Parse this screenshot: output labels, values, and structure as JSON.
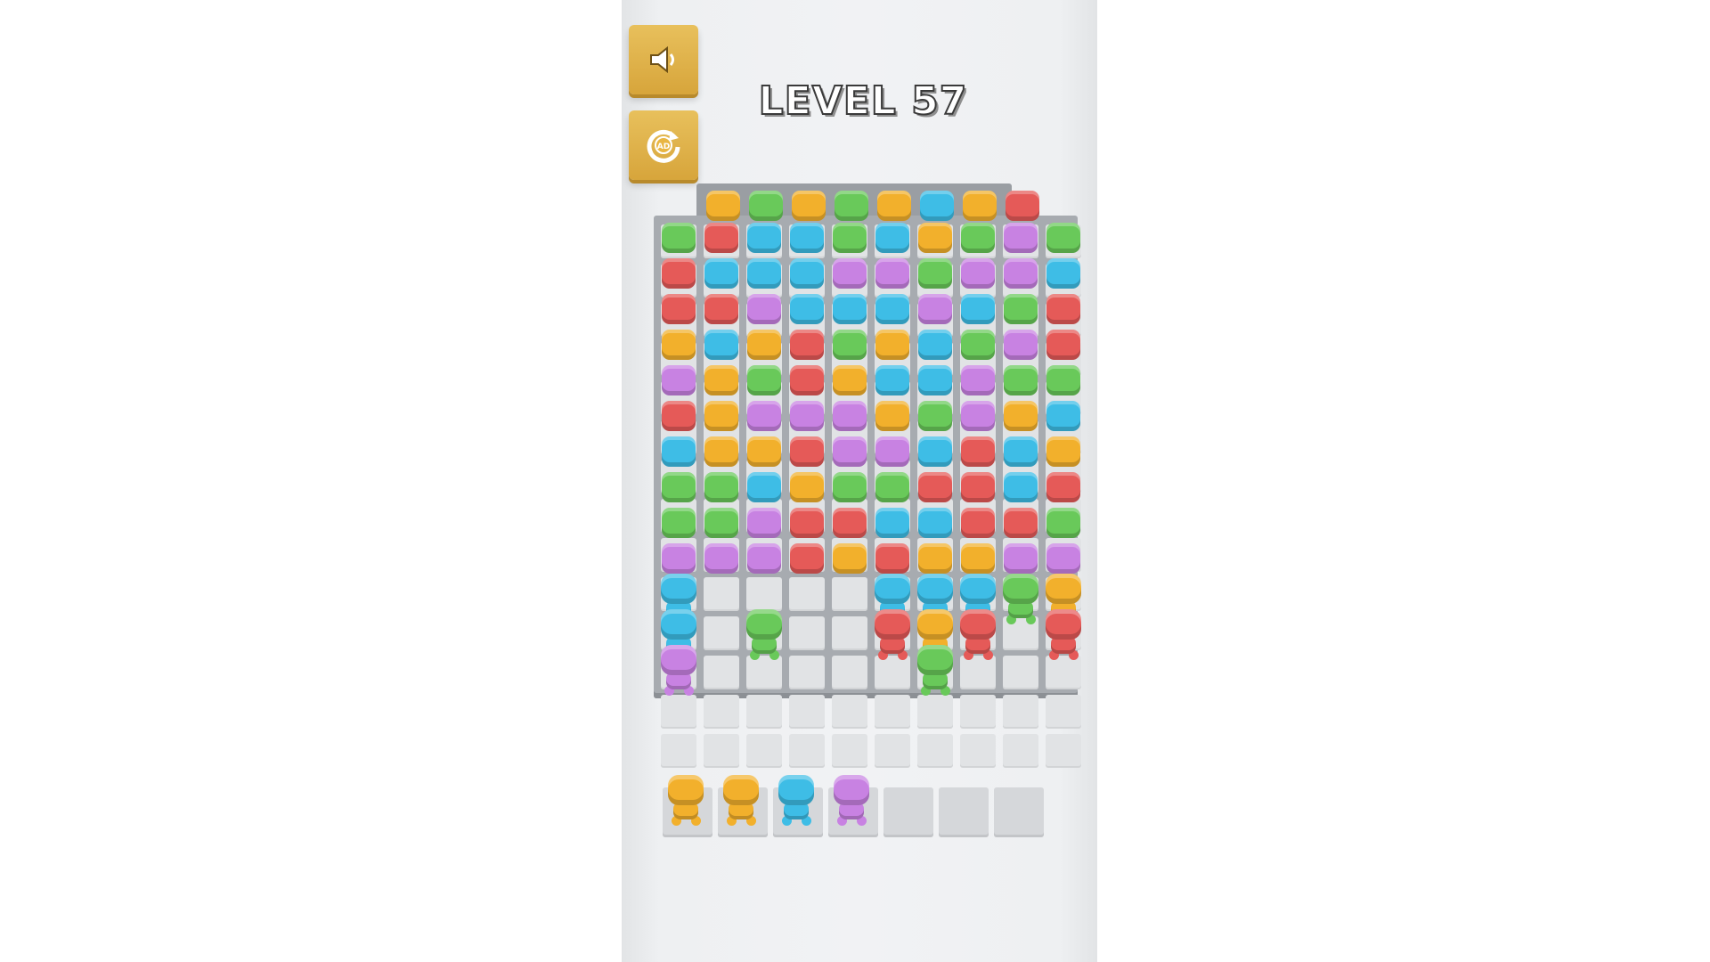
{
  "level": {
    "label": "LEVEL 57"
  },
  "buttons": {
    "sound": {
      "icon": "speaker-icon"
    },
    "restart": {
      "icon": "restart-ad-icon",
      "badge": "AD"
    }
  },
  "colors": {
    "orange": "#f2b02c",
    "green": "#69c95a",
    "blue": "#3ebde6",
    "purple": "#c882e2",
    "red": "#e55a58"
  },
  "board": {
    "cols": 10,
    "rows": 13,
    "top_row": [
      "orange",
      "green",
      "orange",
      "green",
      "orange",
      "blue",
      "orange",
      "red"
    ],
    "rows_blocks": [
      [
        "green",
        "red",
        "blue",
        "blue",
        "green",
        "blue",
        "orange",
        "green",
        "purple",
        "green"
      ],
      [
        "red",
        "blue",
        "blue",
        "blue",
        "purple",
        "purple",
        "green",
        "purple",
        "purple",
        "blue"
      ],
      [
        "red",
        "red",
        "purple",
        "blue",
        "blue",
        "blue",
        "purple",
        "blue",
        "green",
        "red"
      ],
      [
        "orange",
        "blue",
        "orange",
        "red",
        "green",
        "orange",
        "blue",
        "green",
        "purple",
        "red"
      ],
      [
        "purple",
        "orange",
        "green",
        "red",
        "orange",
        "blue",
        "blue",
        "purple",
        "green",
        "green"
      ],
      [
        "red",
        "orange",
        "purple",
        "purple",
        "purple",
        "orange",
        "green",
        "purple",
        "orange",
        "blue"
      ],
      [
        "blue",
        "orange",
        "orange",
        "red",
        "purple",
        "purple",
        "blue",
        "red",
        "blue",
        "orange"
      ],
      [
        "green",
        "green",
        "blue",
        "orange",
        "green",
        "green",
        "red",
        "red",
        "blue",
        "red"
      ],
      [
        "green",
        "green",
        "purple",
        "red",
        "red",
        "blue",
        "blue",
        "red",
        "red",
        "green"
      ],
      [
        "purple",
        "purple",
        "purple",
        "red",
        "orange",
        "red",
        "orange",
        "orange",
        "purple",
        "purple"
      ],
      [
        "blue",
        null,
        null,
        null,
        null,
        "blue",
        "blue",
        "blue",
        "green",
        "orange"
      ],
      [
        "blue",
        null,
        "green",
        null,
        null,
        "red",
        "orange",
        "red",
        null,
        "red"
      ],
      [
        "purple",
        null,
        null,
        null,
        null,
        null,
        "green",
        null,
        null,
        null
      ]
    ]
  },
  "tray": {
    "slots": [
      "orange",
      "orange",
      "blue",
      "purple",
      null,
      null,
      null
    ]
  }
}
